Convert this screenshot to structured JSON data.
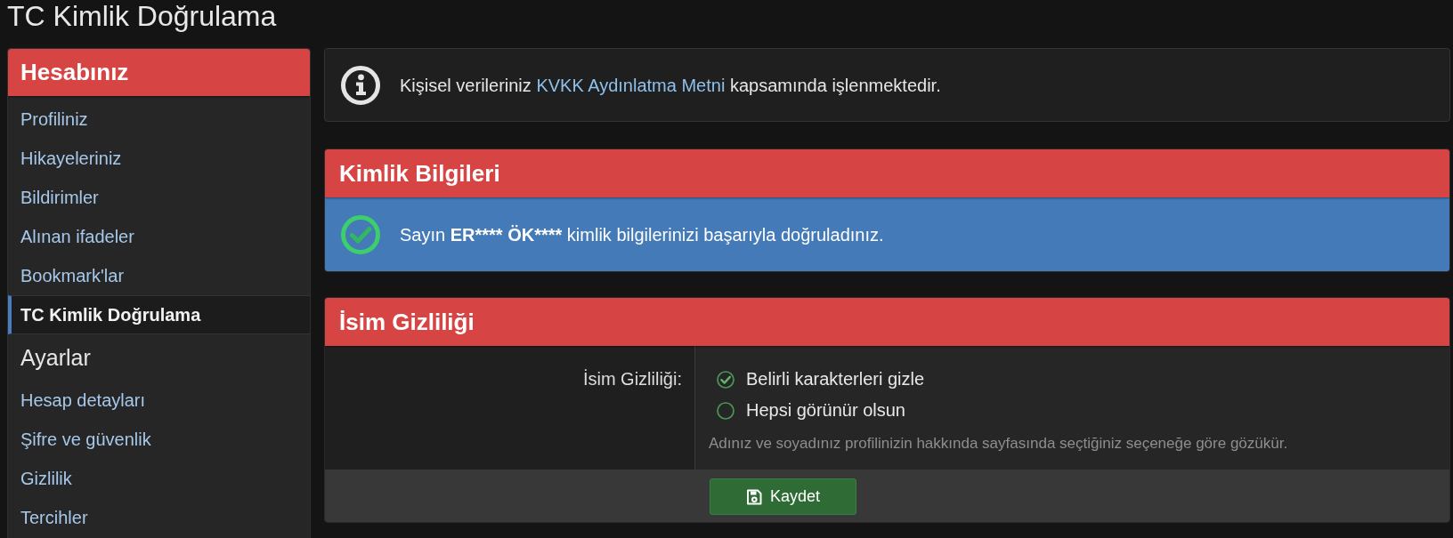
{
  "page": {
    "title": "TC Kimlik Doğrulama"
  },
  "sidebar": {
    "groups": [
      {
        "kind": "banner",
        "title": "Hesabınız",
        "items": [
          {
            "label": "Profiliniz",
            "selected": false
          },
          {
            "label": "Hikayeleriniz",
            "selected": false
          },
          {
            "label": "Bildirimler",
            "selected": false
          },
          {
            "label": "Alınan ifadeler",
            "selected": false
          },
          {
            "label": "Bookmark'lar",
            "selected": false
          },
          {
            "label": "TC Kimlik Doğrulama",
            "selected": true
          }
        ]
      },
      {
        "kind": "plain",
        "title": "Ayarlar",
        "items": [
          {
            "label": "Hesap detayları",
            "selected": false
          },
          {
            "label": "Şifre ve güvenlik",
            "selected": false
          },
          {
            "label": "Gizlilik",
            "selected": false
          },
          {
            "label": "Tercihler",
            "selected": false
          }
        ]
      }
    ]
  },
  "notice": {
    "parts": [
      {
        "kind": "text",
        "text": "Kişisel verileriniz "
      },
      {
        "kind": "link",
        "text": "KVKK Aydınlatma Metni"
      },
      {
        "kind": "text",
        "text": " kapsamında işlenmektedir."
      }
    ]
  },
  "identity": {
    "title": "Kimlik Bilgileri",
    "message": [
      {
        "text": "Sayın ",
        "bold": false
      },
      {
        "text": "ER**** ÖK****",
        "bold": true
      },
      {
        "text": " kimlik bilgilerinizi başarıyla doğruladınız.",
        "bold": false
      }
    ]
  },
  "name_privacy": {
    "title": "İsim Gizliliği",
    "field_label": "İsim Gizliliği:",
    "options": [
      {
        "label": "Belirli karakterleri gizle",
        "selected": true
      },
      {
        "label": "Hepsi görünür olsun",
        "selected": false
      }
    ],
    "hint": "Adınız ve soyadınız profilinizin hakkında sayfasında seçtiğiniz seçeneğe göre gözükür.",
    "save_button": {
      "label": "Kaydet"
    }
  }
}
